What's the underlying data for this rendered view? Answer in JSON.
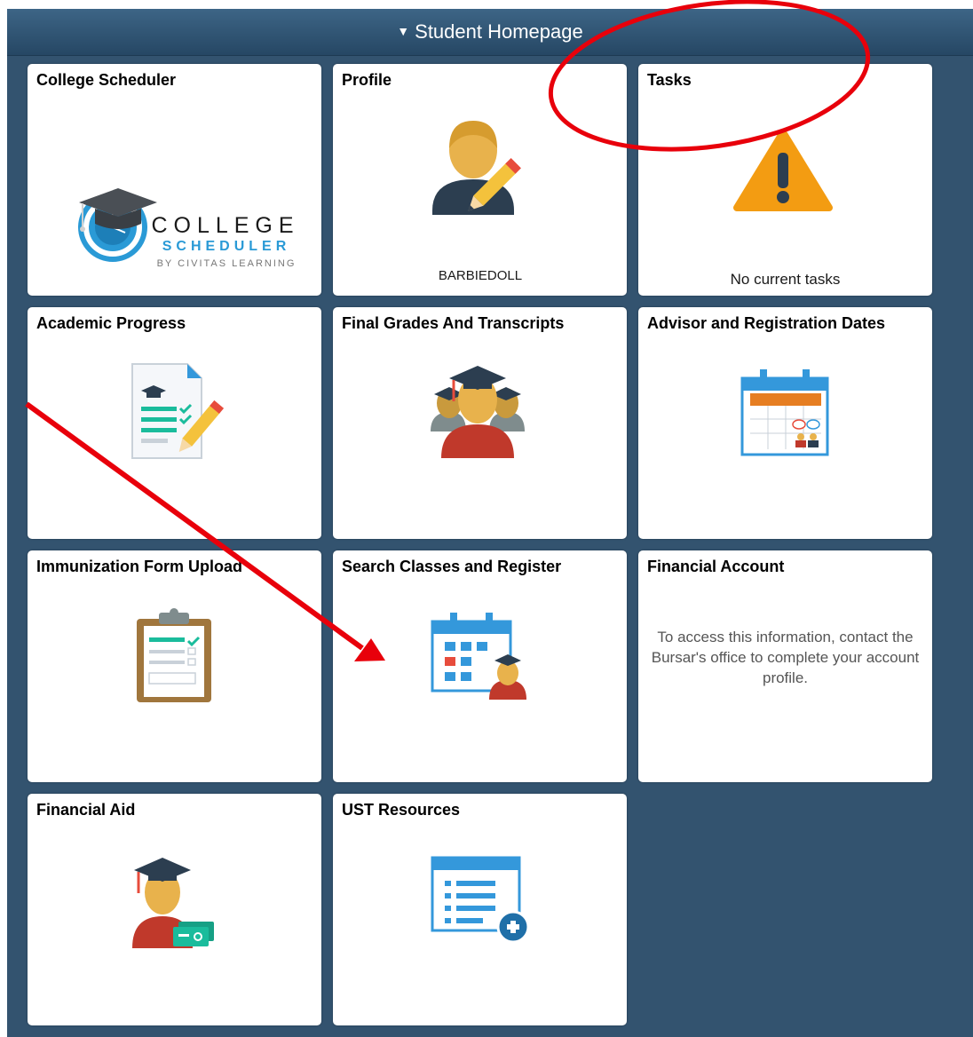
{
  "header": {
    "caret_glyph": "▼",
    "title": "Student Homepage"
  },
  "tiles": [
    {
      "title": "College Scheduler",
      "icon": "college-scheduler-logo-icon",
      "logo": {
        "line1": "COLLEGE",
        "line2": "SCHEDULER",
        "line3": "BY CIVITAS LEARNING"
      }
    },
    {
      "title": "Profile",
      "icon": "profile-person-pencil-icon",
      "caption": "BARBIEDOLL"
    },
    {
      "title": "Tasks",
      "icon": "warning-triangle-icon",
      "caption": "No current tasks"
    },
    {
      "title": "Academic Progress",
      "icon": "checklist-document-pencil-icon"
    },
    {
      "title": "Final Grades And Transcripts",
      "icon": "graduates-group-icon"
    },
    {
      "title": "Advisor and Registration Dates",
      "icon": "calendar-advisor-icon"
    },
    {
      "title": "Immunization Form Upload",
      "icon": "clipboard-checklist-icon"
    },
    {
      "title": "Search Classes and Register",
      "icon": "calendar-graduate-icon"
    },
    {
      "title": "Financial Account",
      "icon": "",
      "message": "To access this information, contact the Bursar's office to complete your account profile."
    },
    {
      "title": "Financial Aid",
      "icon": "graduate-money-icon"
    },
    {
      "title": "UST Resources",
      "icon": "list-window-add-icon"
    }
  ],
  "colors": {
    "panel_background": "#33536f",
    "banner_top": "#3d6586",
    "banner_bottom": "#264764",
    "annotation_red": "#e8000b",
    "warning_orange": "#f39c12",
    "avatar_skin": "#e8b24c",
    "navy": "#2c3e50",
    "calendar_blue": "#3498db",
    "green": "#1abc9c",
    "red": "#c0392b"
  }
}
